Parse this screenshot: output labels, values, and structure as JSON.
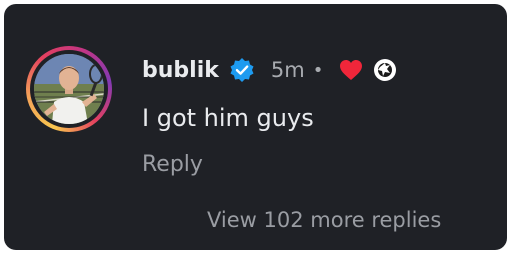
{
  "comment": {
    "username": "bublik",
    "verified": true,
    "time": "5m",
    "separator": "•",
    "liked_by_creator": true,
    "text": "I got him guys",
    "reply_label": "Reply"
  },
  "replies": {
    "view_more_label": "View 102 more replies"
  },
  "icons": {
    "verified": "verified-badge-icon",
    "heart": "heart-icon",
    "creator": "creator-avatar-icon"
  },
  "colors": {
    "background": "#1f2126",
    "primary_text": "#e9ebee",
    "secondary_text": "#9a9da3",
    "verified_blue": "#1d9bf0",
    "heart_red": "#f0263a"
  }
}
